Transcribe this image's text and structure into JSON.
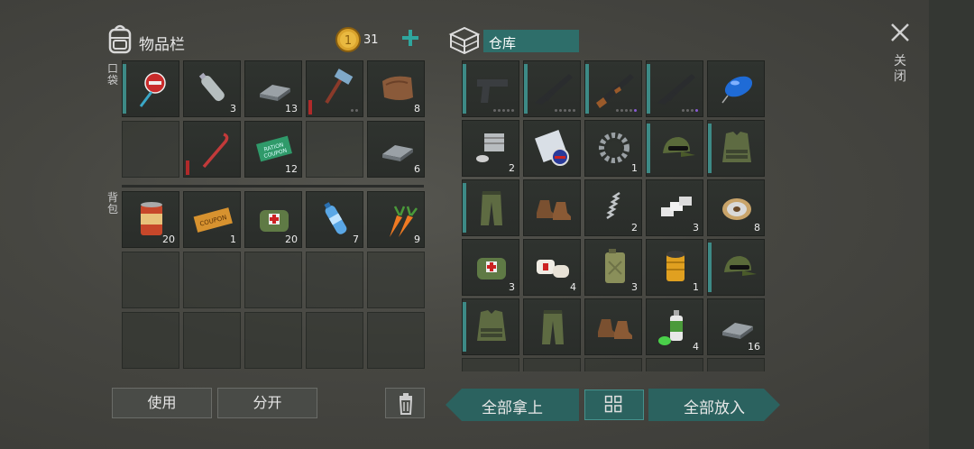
{
  "inventory": {
    "title": "物品栏",
    "coins": "31",
    "pocket_label": "口袋",
    "backpack_label": "背包",
    "pocket_slots": [
      {
        "icon": "stop-sign-icon",
        "qty": "",
        "eq": true
      },
      {
        "icon": "water-bottle-empty-icon",
        "qty": "3"
      },
      {
        "icon": "iron-bar-icon",
        "qty": "13"
      },
      {
        "icon": "hammer-icon",
        "qty": "",
        "durability": true,
        "dots": 2
      },
      {
        "icon": "leather-icon",
        "qty": "8"
      },
      {
        "icon": "",
        "qty": ""
      },
      {
        "icon": "crowbar-icon",
        "qty": "",
        "durability": true
      },
      {
        "icon": "ration-coupon-icon",
        "qty": "12"
      },
      {
        "icon": "",
        "qty": ""
      },
      {
        "icon": "iron-bar-icon",
        "qty": "6"
      }
    ],
    "backpack_slots": [
      {
        "icon": "canned-food-icon",
        "qty": "20"
      },
      {
        "icon": "coupon-ticket-icon",
        "qty": "1"
      },
      {
        "icon": "medkit-bag-icon",
        "qty": "20"
      },
      {
        "icon": "water-bottle-icon",
        "qty": "7"
      },
      {
        "icon": "carrot-icon",
        "qty": "9"
      }
    ],
    "empty_rows": 2
  },
  "storage": {
    "title": "仓库",
    "slots": [
      {
        "icon": "pistol-icon",
        "qty": "",
        "eq": true,
        "dots": 5
      },
      {
        "icon": "m16-rifle-icon",
        "qty": "",
        "eq": true,
        "dots": 5
      },
      {
        "icon": "ak47-rifle-icon",
        "qty": "",
        "eq": true,
        "dots": 5,
        "purple": true
      },
      {
        "icon": "m16-rifle-icon",
        "qty": "",
        "eq": true,
        "dots": 4,
        "purple": true
      },
      {
        "icon": "blue-balloon-icon",
        "qty": ""
      },
      {
        "icon": "engine-parts-icon",
        "qty": "2"
      },
      {
        "icon": "map-scroll-icon",
        "qty": ""
      },
      {
        "icon": "gear-icon",
        "qty": "1"
      },
      {
        "icon": "camo-cap-icon",
        "qty": "",
        "eq": true
      },
      {
        "icon": "camo-vest-icon",
        "qty": "",
        "eq": true
      },
      {
        "icon": "camo-pants-icon",
        "qty": "",
        "eq": true
      },
      {
        "icon": "boots-icon",
        "qty": ""
      },
      {
        "icon": "spring-icon",
        "qty": "2"
      },
      {
        "icon": "aluminum-bars-icon",
        "qty": "3"
      },
      {
        "icon": "wire-spool-icon",
        "qty": "8"
      },
      {
        "icon": "medkit-bag-icon",
        "qty": "3"
      },
      {
        "icon": "bandage-icon",
        "qty": "4"
      },
      {
        "icon": "jerrycan-icon",
        "qty": "3"
      },
      {
        "icon": "oil-filter-icon",
        "qty": "1"
      },
      {
        "icon": "camo-cap-icon",
        "qty": "",
        "eq": true
      },
      {
        "icon": "camo-vest-icon",
        "qty": "",
        "eq": true
      },
      {
        "icon": "camo-pants-icon",
        "qty": ""
      },
      {
        "icon": "boots-icon",
        "qty": ""
      },
      {
        "icon": "spray-paint-icon",
        "qty": "4"
      },
      {
        "icon": "iron-bar-icon",
        "qty": "16"
      },
      {
        "icon": "",
        "qty": ""
      },
      {
        "icon": "",
        "qty": ""
      },
      {
        "icon": "",
        "qty": ""
      },
      {
        "icon": "",
        "qty": ""
      },
      {
        "icon": "",
        "qty": ""
      }
    ]
  },
  "buttons": {
    "use": "使用",
    "split": "分开",
    "take_all": "全部拿上",
    "put_all": "全部放入"
  },
  "close_label": "关闭",
  "colors": {
    "accent": "#2b625f",
    "equip_bar": "#3d8a86",
    "coin": "#d9a32c"
  }
}
